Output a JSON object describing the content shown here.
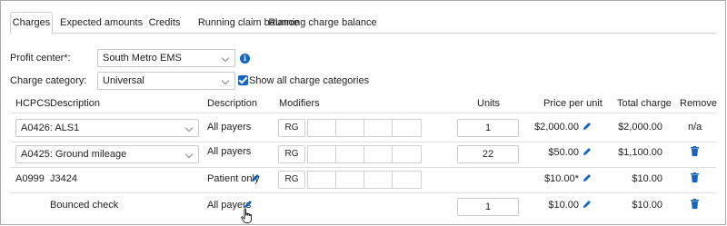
{
  "tabs": [
    {
      "label": "Charges",
      "active": true
    },
    {
      "label": "Expected amounts",
      "active": false
    },
    {
      "label": "Credits",
      "active": false
    },
    {
      "label": "Running claim balance",
      "active": false
    },
    {
      "label": "Running charge balance",
      "active": false
    }
  ],
  "form": {
    "profit_center_label": "Profit center*:",
    "profit_center_value": "South Metro EMS",
    "charge_category_label": "Charge category:",
    "charge_category_value": "Universal",
    "show_all_label": "Show all charge categories",
    "show_all_checked": true
  },
  "table": {
    "headers": {
      "hcpcs": "HCPCS",
      "description": "Description",
      "payer_description": "Description",
      "modifiers": "Modifiers",
      "units": "Units",
      "price": "Price per unit",
      "total": "Total charge",
      "remove": "Remove"
    },
    "rows": [
      {
        "hcpcs_select": "A0426: ALS1",
        "payer": "All payers",
        "modifier": "RG",
        "units": "1",
        "price": "$2,000.00",
        "total": "$2,000.00",
        "remove": "n/a"
      },
      {
        "hcpcs_select": "A0425: Ground mileage",
        "payer": "All payers",
        "modifier": "RG",
        "units": "22",
        "price": "$50.00",
        "total": "$1,100.00",
        "remove": "trash-icon"
      },
      {
        "hcpcs": "A0999",
        "description": "J3424",
        "payer": "Patient only",
        "modifier": "RG",
        "price": "$10.00*",
        "total": "$10.00",
        "remove": "trash-icon"
      },
      {
        "description": "Bounced check",
        "payer": "All payers",
        "units": "1",
        "price": "$10.00",
        "total": "$10.00",
        "remove": "trash-icon"
      }
    ]
  },
  "colors": {
    "accent": "#1565c0",
    "border": "#d0d0d0"
  }
}
